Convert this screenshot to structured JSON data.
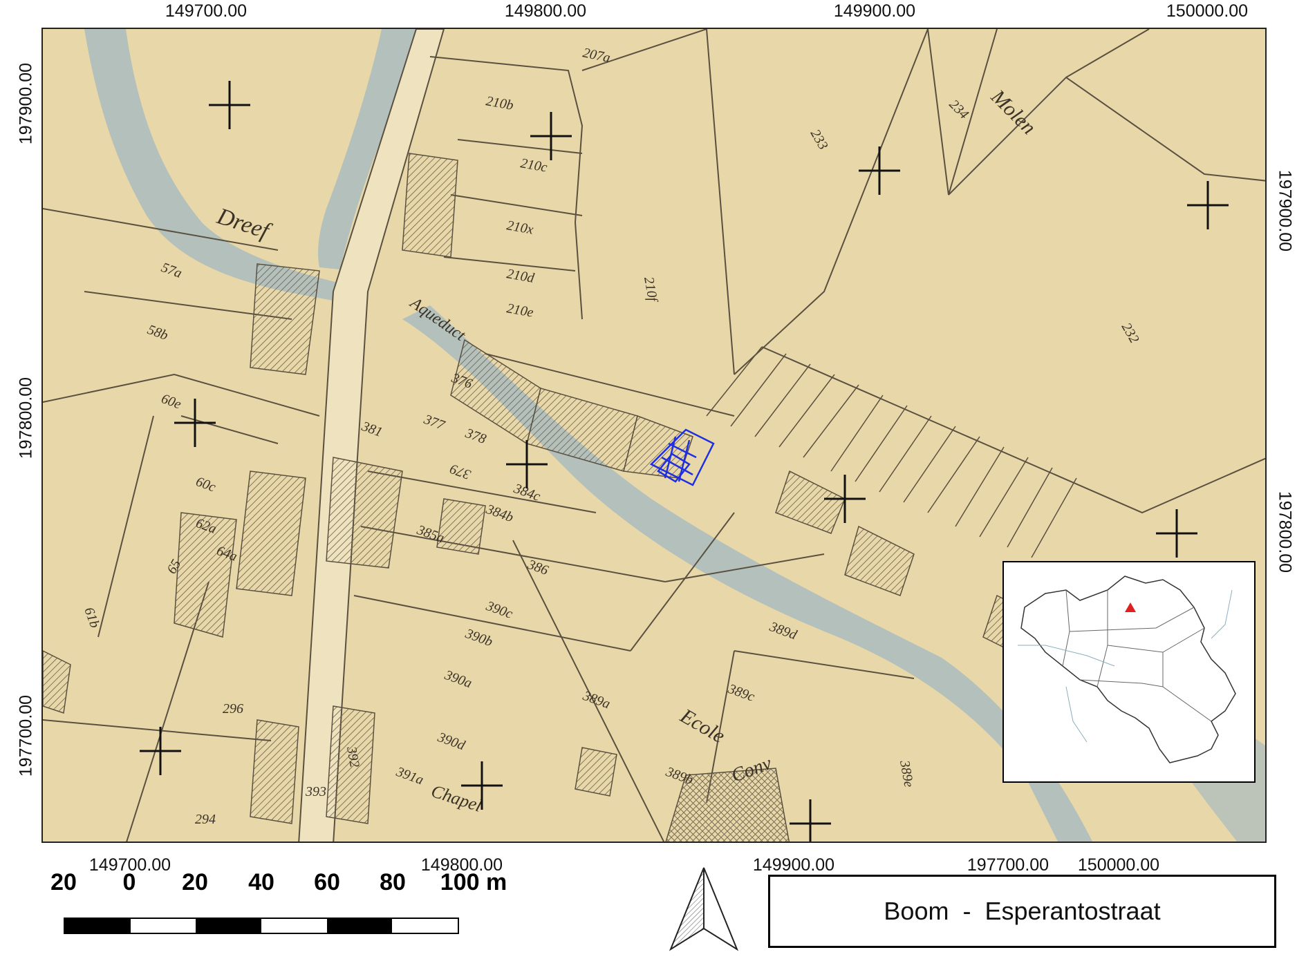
{
  "map": {
    "title": "Boom  -  Esperantostraat",
    "x_coords_top": [
      "149700.00",
      "149800.00",
      "149900.00",
      "150000.00"
    ],
    "x_coords_bottom": [
      "149700.00",
      "149800.00",
      "149900.00",
      "197700.00",
      "150000.00"
    ],
    "y_coords_left": [
      "197900.00",
      "197800.00",
      "197700.00"
    ],
    "y_coords_right": [
      "197900.00",
      "197800.00"
    ],
    "scale_labels": [
      "20",
      "0",
      "20",
      "40",
      "60",
      "80",
      "100 m"
    ],
    "labels": {
      "dreef": "Dreef",
      "molen": "Molen",
      "ecole": "Ecole",
      "aqueduct": "Aqueduct",
      "conv": "Conv",
      "chapel": "Chapel",
      "parcels": [
        "207a",
        "210b",
        "210c",
        "210x",
        "210d",
        "210e",
        "210f",
        "233",
        "234",
        "232",
        "57a",
        "58b",
        "60e",
        "60c",
        "62a",
        "64a",
        "65",
        "61b",
        "376",
        "377",
        "378",
        "379",
        "381",
        "384b",
        "384c",
        "385a",
        "386",
        "390c",
        "390b",
        "390a",
        "390d",
        "389a",
        "389b",
        "389c",
        "389d",
        "389e",
        "391a",
        "392",
        "393",
        "296",
        "294"
      ]
    },
    "colors": {
      "paper": "#e8d7a8",
      "water": "#a9bcc0",
      "ink": "#5a5040",
      "site_outline": "#1f2fe0",
      "inset_marker": "#e02020"
    },
    "icons": [
      "north-arrow-icon",
      "grid-cross-icon",
      "site-marker-icon"
    ]
  }
}
